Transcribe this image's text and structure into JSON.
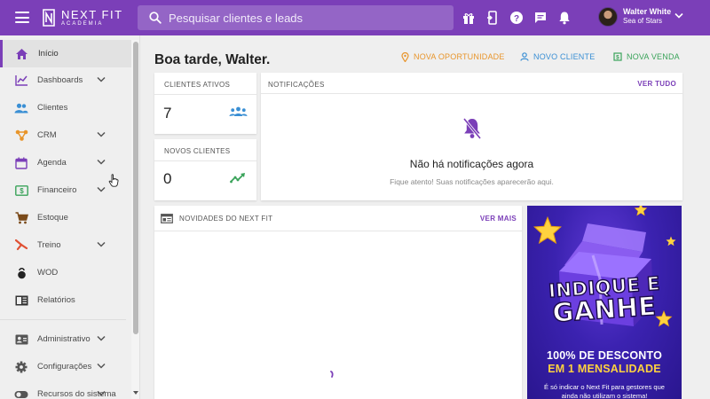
{
  "app": {
    "brand_name": "NEXT FIT",
    "brand_sub": "ACADEMIA",
    "search_placeholder": "Pesquisar clientes e leads"
  },
  "user": {
    "name": "Walter White",
    "subtitle": "Sea of Stars"
  },
  "sidebar": {
    "items": [
      {
        "label": "Início",
        "icon": "home-icon",
        "has_chevron": false,
        "active": true
      },
      {
        "label": "Dashboards",
        "icon": "chart-line-icon",
        "has_chevron": true
      },
      {
        "label": "Clientes",
        "icon": "people-icon",
        "has_chevron": false
      },
      {
        "label": "CRM",
        "icon": "crm-network-icon",
        "has_chevron": true
      },
      {
        "label": "Agenda",
        "icon": "calendar-icon",
        "has_chevron": true
      },
      {
        "label": "Financeiro",
        "icon": "money-icon",
        "has_chevron": true
      },
      {
        "label": "Estoque",
        "icon": "cart-icon",
        "has_chevron": false
      },
      {
        "label": "Treino",
        "icon": "workout-icon",
        "has_chevron": true
      },
      {
        "label": "WOD",
        "icon": "kettlebell-icon",
        "has_chevron": false
      },
      {
        "label": "Relatórios",
        "icon": "report-icon",
        "has_chevron": false
      },
      {
        "label": "Administrativo",
        "icon": "id-card-icon",
        "has_chevron": true
      },
      {
        "label": "Configurações",
        "icon": "gear-icon",
        "has_chevron": true
      },
      {
        "label": "Recursos do sistema",
        "icon": "toggle-icon",
        "has_chevron": true
      }
    ]
  },
  "main": {
    "greeting": "Boa tarde, Walter.",
    "actions": [
      {
        "label": "NOVA OPORTUNIDADE",
        "icon": "location-pin-icon",
        "color": "#e8952b"
      },
      {
        "label": "NOVO CLIENTE",
        "icon": "person-add-icon",
        "color": "#3a8fd4"
      },
      {
        "label": "NOVA VENDA",
        "icon": "receipt-icon",
        "color": "#3aa35a"
      }
    ],
    "clientes_ativos": {
      "title": "CLIENTES ATIVOS",
      "value": "7"
    },
    "novos_clientes": {
      "title": "NOVOS CLIENTES",
      "value": "0"
    },
    "notificacoes": {
      "title": "NOTIFICAÇÕES",
      "link": "VER TUDO",
      "empty_title": "Não há notificações agora",
      "empty_sub": "Fique atento! Suas notificações aparecerão aqui."
    },
    "novidades": {
      "title": "NOVIDADES DO NEXT FIT",
      "link": "VER MAIS"
    }
  },
  "banner": {
    "headline_1": "INDIQUE E",
    "headline_2": "GANHE",
    "promo_1": "100% DE DESCONTO",
    "promo_2": "EM 1 MENSALIDADE",
    "small_text": "É só indicar o Next Fit para gestores que ainda não utilizam o sistema!"
  },
  "colors": {
    "brand": "#7b3fb8",
    "accent_green": "#3aa35a",
    "accent_orange": "#e8952b",
    "accent_blue": "#3a8fd4"
  }
}
